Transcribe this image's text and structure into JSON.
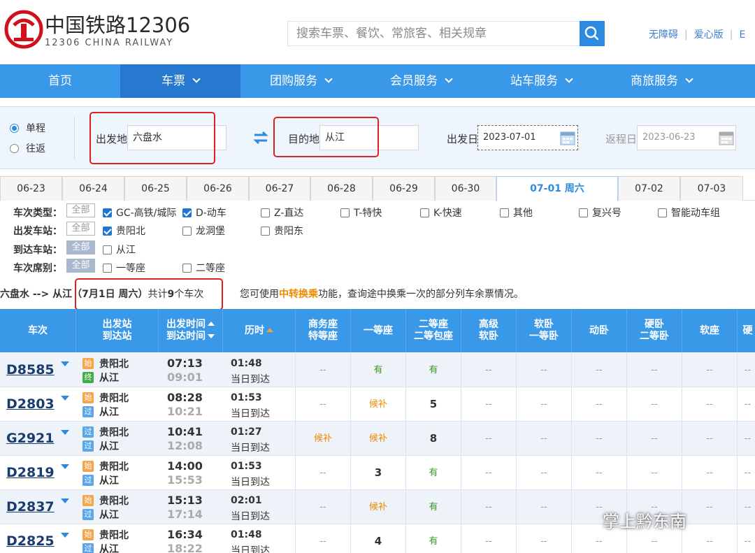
{
  "header": {
    "logo_cn": "中国铁路12306",
    "logo_en": "12306 CHINA RAILWAY",
    "search_placeholder": "搜索车票、餐饮、常旅客、相关规章",
    "links": [
      "无障碍",
      "爱心版",
      "E"
    ]
  },
  "nav": [
    {
      "label": "首页",
      "dropdown": false,
      "active": false
    },
    {
      "label": "车票",
      "dropdown": true,
      "active": true
    },
    {
      "label": "团购服务",
      "dropdown": true,
      "active": false
    },
    {
      "label": "会员服务",
      "dropdown": true,
      "active": false
    },
    {
      "label": "站车服务",
      "dropdown": true,
      "active": false
    },
    {
      "label": "商旅服务",
      "dropdown": true,
      "active": false
    }
  ],
  "query": {
    "trip_types": [
      {
        "label": "单程",
        "selected": true
      },
      {
        "label": "往返",
        "selected": false
      }
    ],
    "from_label": "出发地",
    "from_value": "六盘水",
    "to_label": "目的地",
    "to_value": "从江",
    "depart_label": "出发日",
    "depart_value": "2023-07-01",
    "return_label": "返程日",
    "return_value": "2023-06-23"
  },
  "date_tabs": [
    "06-23",
    "06-24",
    "06-25",
    "06-26",
    "06-27",
    "06-28",
    "06-29",
    "06-30",
    "07-01 周六",
    "07-02",
    "07-03"
  ],
  "active_date_index": 8,
  "filters": {
    "all_label": "全部",
    "rows": [
      {
        "label": "车次类型：",
        "all_dark": false,
        "options": [
          {
            "label": "GC-高铁/城际",
            "checked": true
          },
          {
            "label": "D-动车",
            "checked": true
          },
          {
            "label": "Z-直达",
            "checked": false
          },
          {
            "label": "T-特快",
            "checked": false
          },
          {
            "label": "K-快速",
            "checked": false
          },
          {
            "label": "其他",
            "checked": false
          },
          {
            "label": "复兴号",
            "checked": false
          },
          {
            "label": "智能动车组",
            "checked": false
          }
        ]
      },
      {
        "label": "出发车站：",
        "all_dark": false,
        "options": [
          {
            "label": "贵阳北",
            "checked": true
          },
          {
            "label": "龙洞堡",
            "checked": false
          },
          {
            "label": "贵阳东",
            "checked": false
          }
        ]
      },
      {
        "label": "到达车站：",
        "all_dark": true,
        "options": [
          {
            "label": "从江",
            "checked": false
          }
        ]
      },
      {
        "label": "车次席别：",
        "all_dark": true,
        "options": [
          {
            "label": "一等座",
            "checked": false
          },
          {
            "label": "二等座",
            "checked": false
          }
        ]
      }
    ]
  },
  "summary": {
    "route": "六盘水 --> 从江",
    "date": "（7月1日  周六）",
    "prefix": "共计",
    "count": "9",
    "suffix": "个车次"
  },
  "tip": {
    "pre": "您可使用",
    "link": "中转换乘",
    "post": "功能，查询途中换乘一次的部分列车余票情况。"
  },
  "table": {
    "headers": [
      {
        "l1": "车次",
        "l2": ""
      },
      {
        "l1": "出发站",
        "l2": "到达站"
      },
      {
        "l1": "出发时间",
        "l2": "到达时间"
      },
      {
        "l1": "历时",
        "l2": ""
      },
      {
        "l1": "商务座",
        "l2": "特等座"
      },
      {
        "l1": "一等座",
        "l2": ""
      },
      {
        "l1": "二等座",
        "l2": "二等包座"
      },
      {
        "l1": "高级",
        "l2": "软卧"
      },
      {
        "l1": "软卧",
        "l2": "一等卧"
      },
      {
        "l1": "动卧",
        "l2": ""
      },
      {
        "l1": "硬卧",
        "l2": "二等卧"
      },
      {
        "l1": "软座",
        "l2": ""
      },
      {
        "l1": "硬",
        "l2": ""
      }
    ],
    "rows": [
      {
        "no": "D8585",
        "from_badge": "始",
        "from": "贵阳北",
        "to_badge": "终",
        "to": "从江",
        "dep": "07:13",
        "arr": "09:01",
        "dur": "01:48",
        "day": "当日到达",
        "seats": [
          "--",
          "有",
          "有",
          "--",
          "--",
          "--",
          "--",
          "--",
          "--"
        ]
      },
      {
        "no": "D2803",
        "from_badge": "始",
        "from": "贵阳北",
        "to_badge": "过",
        "to": "从江",
        "dep": "08:28",
        "arr": "10:21",
        "dur": "01:53",
        "day": "当日到达",
        "seats": [
          "--",
          "候补",
          "5",
          "--",
          "--",
          "--",
          "--",
          "--",
          "--"
        ]
      },
      {
        "no": "G2921",
        "from_badge": "过",
        "from": "贵阳北",
        "to_badge": "过",
        "to": "从江",
        "dep": "10:41",
        "arr": "12:08",
        "dur": "01:27",
        "day": "当日到达",
        "seats": [
          "候补",
          "候补",
          "8",
          "--",
          "--",
          "--",
          "--",
          "--",
          "--"
        ]
      },
      {
        "no": "D2819",
        "from_badge": "始",
        "from": "贵阳北",
        "to_badge": "过",
        "to": "从江",
        "dep": "14:00",
        "arr": "15:53",
        "dur": "01:53",
        "day": "当日到达",
        "seats": [
          "--",
          "3",
          "有",
          "--",
          "--",
          "--",
          "--",
          "--",
          "--"
        ]
      },
      {
        "no": "D2837",
        "from_badge": "始",
        "from": "贵阳北",
        "to_badge": "过",
        "to": "从江",
        "dep": "15:13",
        "arr": "17:14",
        "dur": "02:01",
        "day": "当日到达",
        "seats": [
          "--",
          "候补",
          "有",
          "--",
          "--",
          "--",
          "--",
          "--",
          "--"
        ]
      },
      {
        "no": "D2825",
        "from_badge": "始",
        "from": "贵阳北",
        "to_badge": "过",
        "to": "从江",
        "dep": "16:34",
        "arr": "18:22",
        "dur": "01:48",
        "day": "当日到达",
        "seats": [
          "--",
          "4",
          "有",
          "--",
          "--",
          "--",
          "--",
          "--",
          "--"
        ]
      }
    ]
  },
  "watermark": "掌上黔东南",
  "colors": {
    "nav": "#3a98e8",
    "nav_active": "#2779d0",
    "available": "#3a9a1f",
    "waitlist": "#f08a00",
    "highlight_box": "#e02020"
  }
}
